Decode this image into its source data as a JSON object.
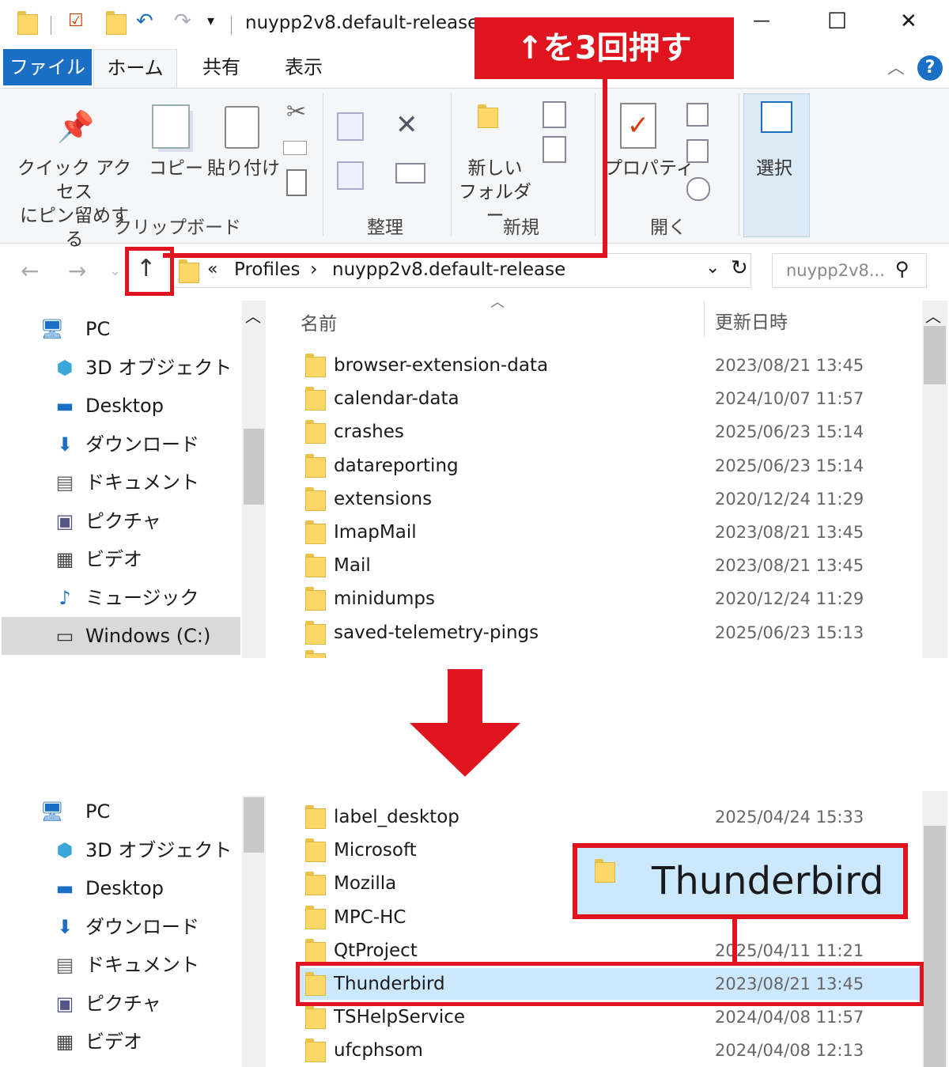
{
  "titlebar": {
    "path_title": "nuypp2v8.default-release",
    "minimize": "—",
    "maximize": "☐",
    "close": "✕"
  },
  "ribbon": {
    "tabs": [
      "ファイル",
      "ホーム",
      "共有",
      "表示"
    ],
    "quick_access": [
      "クイック アクセス",
      "にピン留めする"
    ],
    "copy": "コピー",
    "paste": "貼り付け",
    "new_folder": [
      "新しい",
      "フォルダー"
    ],
    "properties": "プロパティ",
    "select": "選択",
    "groups": [
      "クリップボード",
      "整理",
      "新規",
      "開く"
    ]
  },
  "callout": {
    "text": "↑を3回押す"
  },
  "addressbar": {
    "chevron": "«",
    "crumbs": [
      "Profiles",
      "nuypp2v8.default-release"
    ],
    "separator": "›",
    "search_placeholder": "nuypp2v8..."
  },
  "columns": {
    "name": "名前",
    "date": "更新日時"
  },
  "nav_top": [
    {
      "label": "PC",
      "icon": "pc-icon"
    },
    {
      "label": "3D オブジェクト",
      "icon": "3d-objects-icon"
    },
    {
      "label": "Desktop",
      "icon": "desktop-icon"
    },
    {
      "label": "ダウンロード",
      "icon": "download-icon"
    },
    {
      "label": "ドキュメント",
      "icon": "document-icon"
    },
    {
      "label": "ピクチャ",
      "icon": "pictures-icon"
    },
    {
      "label": "ビデオ",
      "icon": "video-icon"
    },
    {
      "label": "ミュージック",
      "icon": "music-icon"
    },
    {
      "label": "Windows (C:)",
      "icon": "drive-icon"
    }
  ],
  "files_top": [
    {
      "name": "browser-extension-data",
      "date": "2023/08/21 13:45"
    },
    {
      "name": "calendar-data",
      "date": "2024/10/07 11:57"
    },
    {
      "name": "crashes",
      "date": "2025/06/23 15:14"
    },
    {
      "name": "datareporting",
      "date": "2025/06/23 15:14"
    },
    {
      "name": "extensions",
      "date": "2020/12/24 11:29"
    },
    {
      "name": "ImapMail",
      "date": "2023/08/21 13:45"
    },
    {
      "name": "Mail",
      "date": "2023/08/21 13:45"
    },
    {
      "name": "minidumps",
      "date": "2020/12/24 11:29"
    },
    {
      "name": "saved-telemetry-pings",
      "date": "2025/06/23 15:13"
    }
  ],
  "nav_bottom": [
    {
      "label": "PC",
      "icon": "pc-icon"
    },
    {
      "label": "3D オブジェクト",
      "icon": "3d-objects-icon"
    },
    {
      "label": "Desktop",
      "icon": "desktop-icon"
    },
    {
      "label": "ダウンロード",
      "icon": "download-icon"
    },
    {
      "label": "ドキュメント",
      "icon": "document-icon"
    },
    {
      "label": "ピクチャ",
      "icon": "pictures-icon"
    },
    {
      "label": "ビデオ",
      "icon": "video-icon"
    }
  ],
  "files_bottom": [
    {
      "name": "label_desktop",
      "date": "2025/04/24 15:33"
    },
    {
      "name": "Microsoft",
      "date": ""
    },
    {
      "name": "Mozilla",
      "date": ""
    },
    {
      "name": "MPC-HC",
      "date": ""
    },
    {
      "name": "QtProject",
      "date": "2025/04/11 11:21"
    },
    {
      "name": "Thunderbird",
      "date": "2023/08/21 13:45",
      "selected": true
    },
    {
      "name": "TSHelpService",
      "date": "2024/04/08 11:57"
    },
    {
      "name": "ufcphsom",
      "date": "2024/04/08 12:13"
    }
  ],
  "zoom_callout": {
    "label": "Thunderbird"
  },
  "colors": {
    "accent_red": "#e0141e",
    "file_tab": "#1a6fc4",
    "selection": "#cce8ff",
    "folder": "#fbd868"
  }
}
